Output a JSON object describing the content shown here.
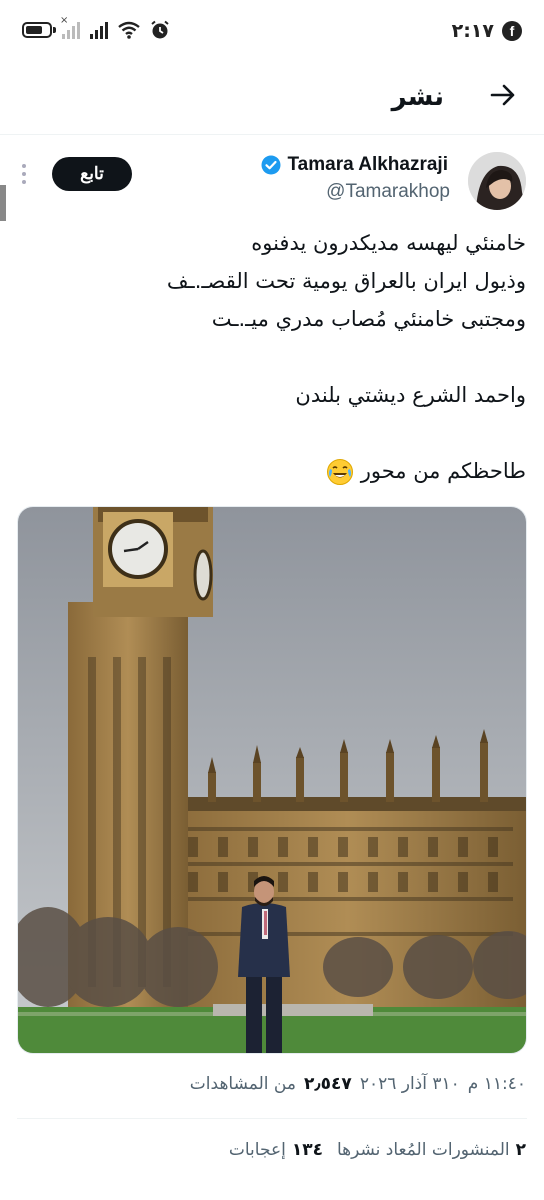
{
  "status_bar": {
    "time": "٢:١٧",
    "icons": [
      "facebook-icon",
      "alarm-icon",
      "wifi-icon",
      "signal-icon",
      "signal-no-sim-icon",
      "battery-icon"
    ]
  },
  "header": {
    "title": "نشر",
    "back_icon": "arrow-right-icon"
  },
  "author": {
    "name": "Tamara Alkhazraji",
    "handle": "@Tamarakhop",
    "verified": true,
    "follow_label": "تابع"
  },
  "tweet": {
    "lines": [
      "خامنئي ليهسه مديكدرون يدفنوه",
      "وذيول ايران بالعراق يومية تحت القصـ.ـف",
      "ومجتبى خامنئي مُصاب مدري ميـ.ـت",
      "",
      "واحمد الشرع ديشتي بلندن",
      "",
      "طاحظكم من محور"
    ],
    "emoji": "face-with-tears-of-joy"
  },
  "meta": {
    "time": "١١:٤٠ م",
    "date": "٣١٠ آذار ٢٠٢٦",
    "views_count": "٢٫٥٤٧",
    "views_label": "من المشاهدات"
  },
  "stats": {
    "reposts_count": "٢",
    "reposts_label": "المنشورات المُعاد نشرها",
    "likes_count": "١٣٤",
    "likes_label": "إعجابات"
  },
  "colors": {
    "text": "#0f1419",
    "secondary": "#536471",
    "verified": "#1d9bf0",
    "divider": "#eff3f4"
  }
}
